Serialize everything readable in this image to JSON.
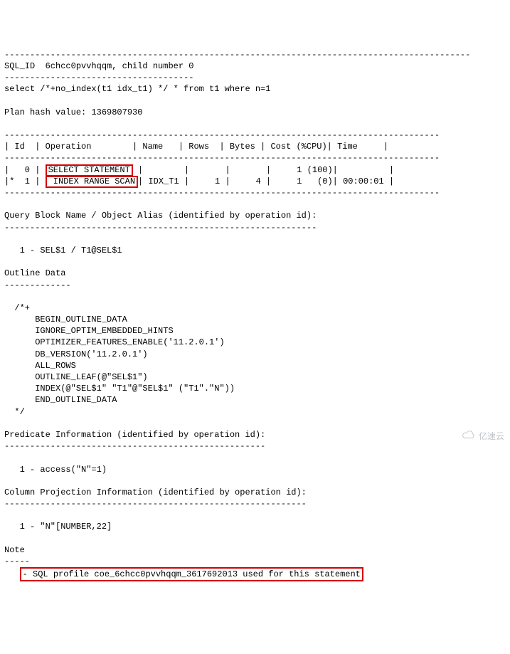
{
  "dash_full": "-------------------------------------------------------------------------------------------",
  "sql_id_line": "SQL_ID  6chcc0pvvhqqm, child number 0",
  "sql_dash": "-------------------------------------",
  "select_stmt": "select /*+no_index(t1 idx_t1) */ * from t1 where n=1",
  "plan_hash": "Plan hash value: 1369807930",
  "tbl_border": "-------------------------------------------------------------------------------------",
  "tbl_header": "| Id  | Operation        | Name   | Rows  | Bytes | Cost (%CPU)| Time     |",
  "row0_prefix": "|   0 | ",
  "row0_op": "SELECT STATEMENT",
  "row0_suffix": "|        |       |       |     1 (100)|          |",
  "row1_prefix": "|*  1 | ",
  "row1_op": " INDEX RANGE SCAN",
  "row1_suffix": "| IDX_T1 |     1 |     4 |     1   (0)| 00:00:01 |",
  "qblock_heading": "Query Block Name / Object Alias (identified by operation id):",
  "qblock_dash": "-------------------------------------------------------------",
  "qblock_line": "   1 - SEL$1 / T1@SEL$1",
  "outline_heading": "Outline Data",
  "outline_dash": "-------------",
  "outline_open": "  /*+",
  "outline_l1": "      BEGIN_OUTLINE_DATA",
  "outline_l2": "      IGNORE_OPTIM_EMBEDDED_HINTS",
  "outline_l3": "      OPTIMIZER_FEATURES_ENABLE('11.2.0.1')",
  "outline_l4": "      DB_VERSION('11.2.0.1')",
  "outline_l5": "      ALL_ROWS",
  "outline_l6": "      OUTLINE_LEAF(@\"SEL$1\")",
  "outline_l7": "      INDEX(@\"SEL$1\" \"T1\"@\"SEL$1\" (\"T1\".\"N\"))",
  "outline_l8": "      END_OUTLINE_DATA",
  "outline_close": "  */",
  "pred_heading": "Predicate Information (identified by operation id):",
  "pred_dash": "---------------------------------------------------",
  "pred_line": "   1 - access(\"N\"=1)",
  "colproj_heading": "Column Projection Information (identified by operation id):",
  "colproj_dash": "-----------------------------------------------------------",
  "colproj_line": "   1 - \"N\"[NUMBER,22]",
  "note_heading": "Note",
  "note_dash": "-----",
  "note_profile_prefix": "   ",
  "note_profile": "- SQL profile coe_6chcc0pvvhqqm_3617692013 used for this statement",
  "watermark_text": "亿速云"
}
